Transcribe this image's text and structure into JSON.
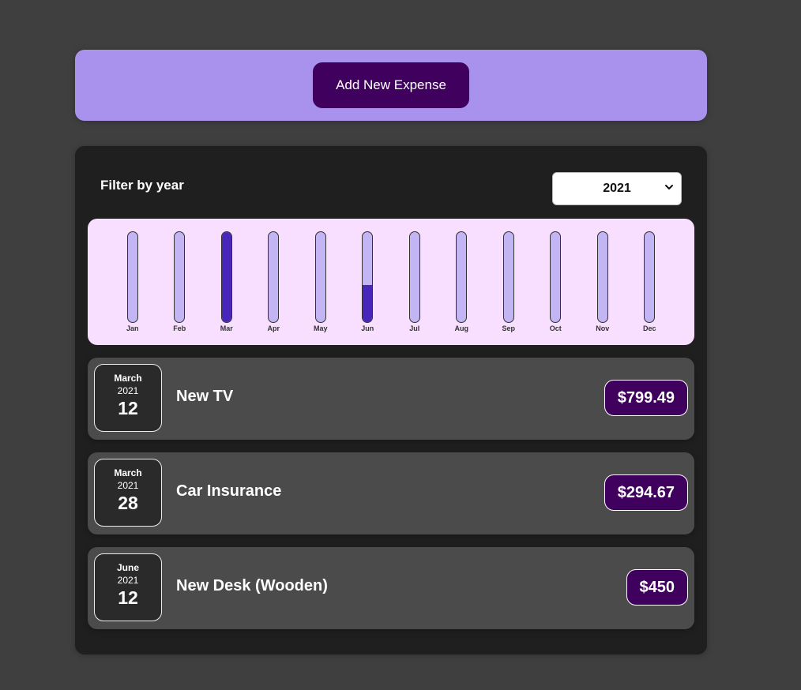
{
  "new_expense": {
    "button_label": "Add New Expense"
  },
  "filter": {
    "label": "Filter by year",
    "selected_year": "2021"
  },
  "chart_data": {
    "type": "bar",
    "categories": [
      "Jan",
      "Feb",
      "Mar",
      "Apr",
      "May",
      "Jun",
      "Jul",
      "Aug",
      "Sep",
      "Oct",
      "Nov",
      "Dec"
    ],
    "values": [
      0,
      0,
      1094.16,
      0,
      0,
      450,
      0,
      0,
      0,
      0,
      0,
      0
    ],
    "max": 1094.16,
    "colors": {
      "fill": "#4826b9",
      "empty": "#c3b4f3",
      "background": "#f8dfff"
    }
  },
  "expenses": [
    {
      "month": "March",
      "year": "2021",
      "day": "12",
      "title": "New TV",
      "amount": "$799.49"
    },
    {
      "month": "March",
      "year": "2021",
      "day": "28",
      "title": "Car Insurance",
      "amount": "$294.67"
    },
    {
      "month": "June",
      "year": "2021",
      "day": "12",
      "title": "New Desk (Wooden)",
      "amount": "$450"
    }
  ],
  "colors": {
    "page_bg": "#3f3f3f",
    "header_bg": "#a892ee",
    "button_bg": "#40005d",
    "panel_bg": "#1f1f1f",
    "item_bg": "#4b4b4b"
  }
}
